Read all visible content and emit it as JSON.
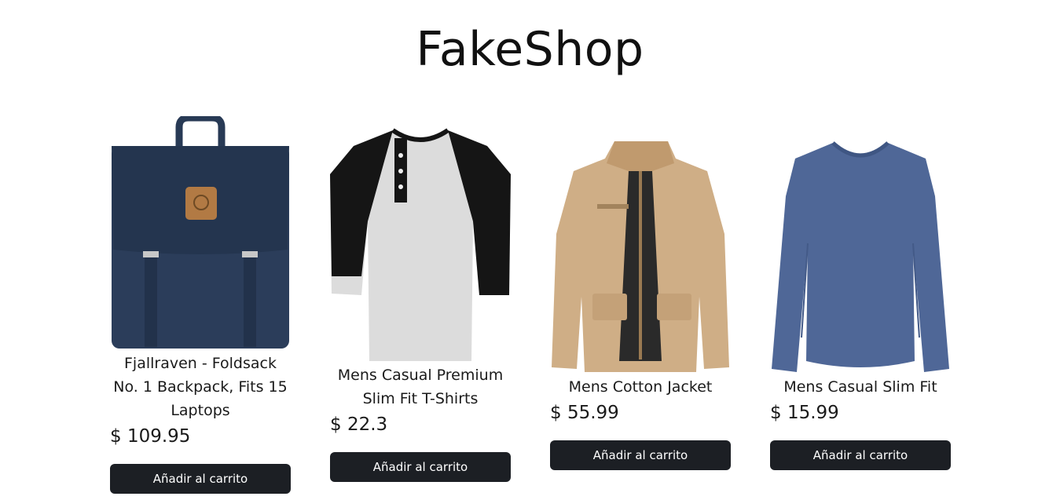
{
  "header": {
    "title": "FakeShop"
  },
  "products": [
    {
      "title": "Fjallraven - Foldsack No. 1 Backpack, Fits 15 Laptops",
      "price": "$ 109.95",
      "button_label": "Añadir al carrito",
      "image_icon": "backpack-image"
    },
    {
      "title": "Mens Casual Premium Slim Fit T-Shirts",
      "price": "$ 22.3",
      "button_label": "Añadir al carrito",
      "image_icon": "raglan-shirt-image"
    },
    {
      "title": "Mens Cotton Jacket",
      "price": "$ 55.99",
      "button_label": "Añadir al carrito",
      "image_icon": "jacket-image"
    },
    {
      "title": "Mens Casual Slim Fit",
      "price": "$ 15.99",
      "button_label": "Añadir al carrito",
      "image_icon": "long-sleeve-shirt-image"
    }
  ],
  "colors": {
    "button_bg": "#1c1f24",
    "button_text": "#ffffff",
    "text": "#111111"
  }
}
